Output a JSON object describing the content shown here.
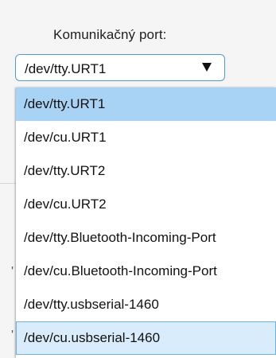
{
  "form": {
    "port_label": "Komunikačný port:",
    "selected_value": "/dev/tty.URT1"
  },
  "dropdown": {
    "options": [
      {
        "label": "/dev/tty.URT1",
        "state": "selected"
      },
      {
        "label": "/dev/cu.URT1",
        "state": "normal"
      },
      {
        "label": "/dev/tty.URT2",
        "state": "normal"
      },
      {
        "label": "/dev/cu.URT2",
        "state": "normal"
      },
      {
        "label": "/dev/tty.Bluetooth-Incoming-Port",
        "state": "normal"
      },
      {
        "label": "/dev/cu.Bluetooth-Incoming-Port",
        "state": "normal"
      },
      {
        "label": "/dev/tty.usbserial-1460",
        "state": "normal"
      },
      {
        "label": "/dev/cu.usbserial-1460",
        "state": "hover"
      }
    ]
  },
  "background_fragments": {
    "glyph_1": "'",
    "glyph_2": "'"
  },
  "colors": {
    "select_border": "#4d9cd9",
    "selected_option_bg": "#a9d3f5",
    "hover_option_bg": "#d9ecfb",
    "hover_option_border": "#6fb1e6"
  },
  "icons": {
    "dropdown_arrow": "triangle-down-icon"
  }
}
